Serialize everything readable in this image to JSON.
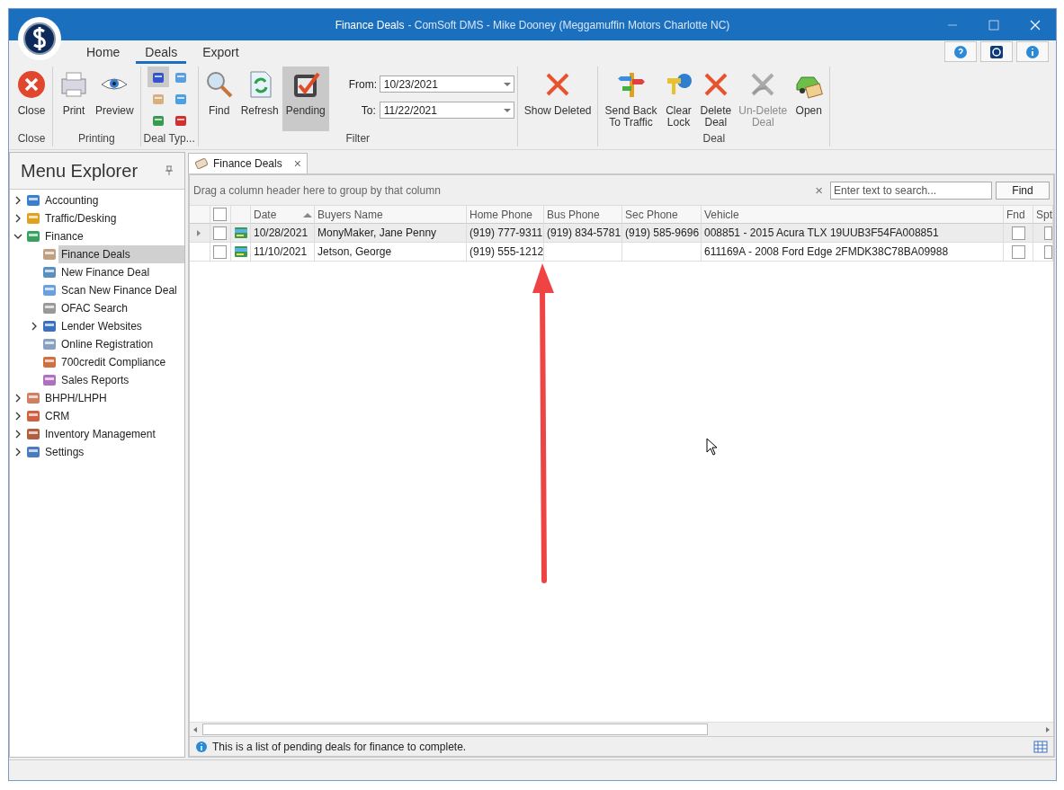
{
  "window": {
    "title": "Finance Deals",
    "subtitle": "- ComSoft DMS - Mike Dooney (Meggamuffin Motors Charlotte NC)"
  },
  "ribbon": {
    "tabs": [
      {
        "label": "Home",
        "selected": false
      },
      {
        "label": "Deals",
        "selected": true
      },
      {
        "label": "Export",
        "selected": false
      }
    ],
    "groups": [
      {
        "label": "Close",
        "items": [
          {
            "label": "Close",
            "selected": false,
            "disabled": false
          }
        ]
      },
      {
        "label": "Printing",
        "items": [
          {
            "label": "Print",
            "selected": false,
            "disabled": false
          },
          {
            "label": "Preview",
            "selected": false,
            "disabled": false
          }
        ]
      },
      {
        "label": "Deal Typ...",
        "small_items": [
          {
            "selected": true
          },
          {
            "selected": false
          },
          {
            "selected": false
          },
          {
            "selected": false
          },
          {
            "selected": false
          },
          {
            "selected": false
          }
        ]
      },
      {
        "label": "Filter",
        "items": [
          {
            "label": "Find",
            "selected": false,
            "disabled": false
          },
          {
            "label": "Refresh",
            "selected": false,
            "disabled": false
          },
          {
            "label": "Pending",
            "selected": true,
            "disabled": false
          }
        ],
        "dates": [
          {
            "label": "From:",
            "value": "10/23/2021"
          },
          {
            "label": "To:",
            "value": "11/22/2021"
          }
        ]
      },
      {
        "items": [
          {
            "label": "Show Deleted",
            "selected": false,
            "disabled": false
          }
        ]
      },
      {
        "label": "Deal",
        "items": [
          {
            "label": "Send Back\nTo Traffic",
            "selected": false,
            "disabled": false
          },
          {
            "label": "Clear\nLock",
            "selected": false,
            "disabled": false
          },
          {
            "label": "Delete\nDeal",
            "selected": false,
            "disabled": false
          },
          {
            "label": "Un-Delete\nDeal",
            "selected": false,
            "disabled": true
          },
          {
            "label": "Open",
            "selected": false,
            "disabled": false
          }
        ]
      }
    ]
  },
  "sidebar": {
    "title": "Menu Explorer",
    "items": [
      {
        "label": "Accounting",
        "expanded": false,
        "selected": false
      },
      {
        "label": "Traffic/Desking",
        "expanded": false,
        "selected": false
      },
      {
        "label": "Finance",
        "expanded": true,
        "selected": false,
        "children": [
          {
            "label": "Finance Deals",
            "selected": true
          },
          {
            "label": "New Finance Deal",
            "selected": false
          },
          {
            "label": "Scan New Finance Deal",
            "selected": false
          },
          {
            "label": "OFAC Search",
            "selected": false
          },
          {
            "label": "Lender Websites",
            "expanded": false,
            "selected": false
          },
          {
            "label": "Online Registration",
            "selected": false
          },
          {
            "label": "700credit Compliance",
            "selected": false
          },
          {
            "label": "Sales Reports",
            "selected": false
          }
        ]
      },
      {
        "label": "BHPH/LHPH",
        "expanded": false,
        "selected": false
      },
      {
        "label": "CRM",
        "expanded": false,
        "selected": false
      },
      {
        "label": "Inventory Management",
        "expanded": false,
        "selected": false
      },
      {
        "label": "Settings",
        "expanded": false,
        "selected": false
      }
    ]
  },
  "document_tab": {
    "label": "Finance Deals",
    "close": "×"
  },
  "grid": {
    "group_hint": "Drag a column header here to group by that column",
    "search": {
      "placeholder": "Enter text to search...",
      "clear": "×",
      "button": "Find"
    },
    "header_checked": false,
    "columns": [
      {
        "label": "Date",
        "sorted": true
      },
      {
        "label": "Buyers Name",
        "sorted": false
      },
      {
        "label": "Home Phone",
        "sorted": false
      },
      {
        "label": "Bus Phone",
        "sorted": false
      },
      {
        "label": "Sec Phone",
        "sorted": false
      },
      {
        "label": "Vehicle",
        "sorted": false
      },
      {
        "label": "Fnd",
        "sorted": false
      },
      {
        "label": "Spt",
        "sorted": false
      }
    ],
    "rows": [
      {
        "selected": true,
        "checked": false,
        "cells": [
          "10/28/2021",
          "MonyMaker, Jane Penny",
          "(919) 777-9311",
          "(919) 834-5781",
          "(919) 585-9696",
          "008851 - 2015 Acura TLX 19UUB3F54FA008851"
        ],
        "fnd": false,
        "spt": false
      },
      {
        "selected": false,
        "checked": false,
        "cells": [
          "11/10/2021",
          "Jetson, George",
          "(919) 555-1212",
          "",
          "",
          "611169A - 2008 Ford Edge 2FMDK38C78BA09988"
        ],
        "fnd": false,
        "spt": false
      }
    ]
  },
  "status": "This is a list of pending deals for finance to complete."
}
